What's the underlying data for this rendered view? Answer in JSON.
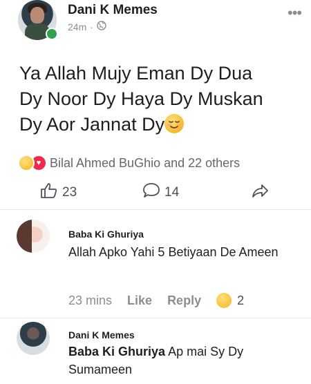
{
  "post": {
    "author": "Dani K Memes",
    "time": "24m",
    "separator": "·",
    "privacy_icon": "globe-icon",
    "more_icon": "ellipsis-icon",
    "text_line1": "Ya Allah Mujy Eman Dy Dua",
    "text_line2": "Dy Noor Dy Haya Dy Muskan",
    "text_line3": "Dy Aor Jannat Dy",
    "text_emoji": "relieved-face-emoji"
  },
  "reactions": {
    "icons": [
      "haha-reaction-icon",
      "love-reaction-icon"
    ],
    "summary": "Bilal Ahmed BuGhio and 22 others"
  },
  "actions": {
    "like_count": "23",
    "comment_count": "14",
    "share_icon": "share-arrow-icon"
  },
  "comments": [
    {
      "author": "Baba Ki Ghuriya",
      "text": "Allah Apko Yahi 5 Betiyaan De Ameen",
      "time": "23 mins",
      "like_label": "Like",
      "reply_label": "Reply",
      "reaction_icon": "haha-reaction-icon",
      "reaction_count": "2"
    },
    {
      "author": "Dani K Memes",
      "mention": "Baba Ki Ghuriya",
      "text": "Ap mai Sy Dy Sumameen"
    }
  ],
  "colors": {
    "online": "#31a24c",
    "text": "#1c1e21",
    "muted": "#8a8d91",
    "love": "#f0284a",
    "haha": "#f4b320"
  }
}
